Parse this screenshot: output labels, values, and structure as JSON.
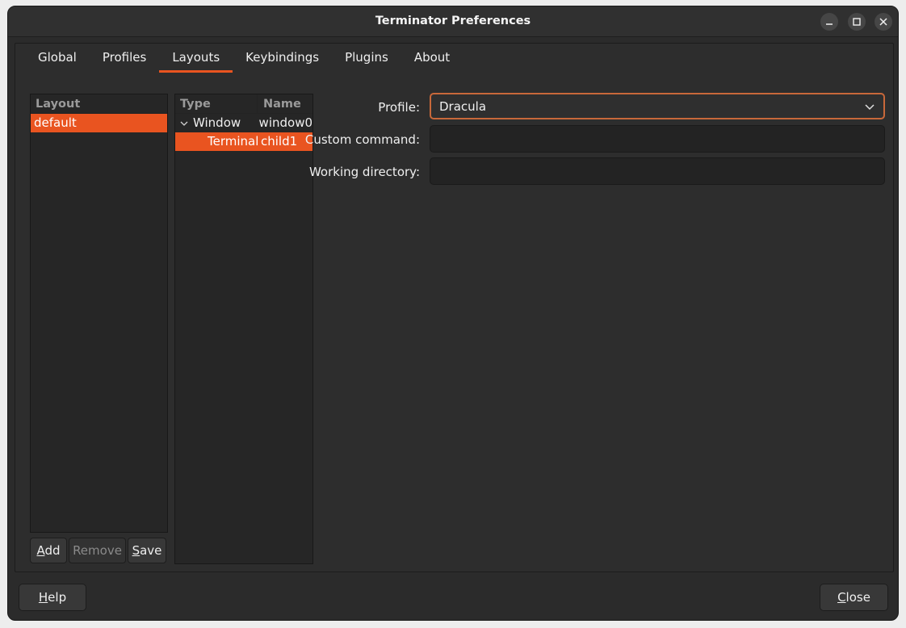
{
  "window": {
    "title": "Terminator Preferences"
  },
  "tabs": [
    {
      "label": "Global"
    },
    {
      "label": "Profiles"
    },
    {
      "label": "Layouts"
    },
    {
      "label": "Keybindings"
    },
    {
      "label": "Plugins"
    },
    {
      "label": "About"
    }
  ],
  "active_tab": "Layouts",
  "layouts_list": {
    "header": "Layout",
    "items": [
      {
        "label": "default"
      }
    ]
  },
  "layout_buttons": {
    "add": "Add",
    "remove": "Remove",
    "save": "Save"
  },
  "tree": {
    "headers": {
      "type": "Type",
      "name": "Name"
    },
    "rows": [
      {
        "type": "Window",
        "name": "window0"
      },
      {
        "type": "Terminal",
        "name": "child1"
      }
    ]
  },
  "form": {
    "profile_label": "Profile:",
    "profile_value": "Dracula",
    "custom_command_label": "Custom command:",
    "custom_command_value": "",
    "working_directory_label": "Working directory:",
    "working_directory_value": ""
  },
  "footer": {
    "help": "Help",
    "close": "Close"
  },
  "colors": {
    "accent": "#e95420",
    "background": "#2b2b2b"
  }
}
